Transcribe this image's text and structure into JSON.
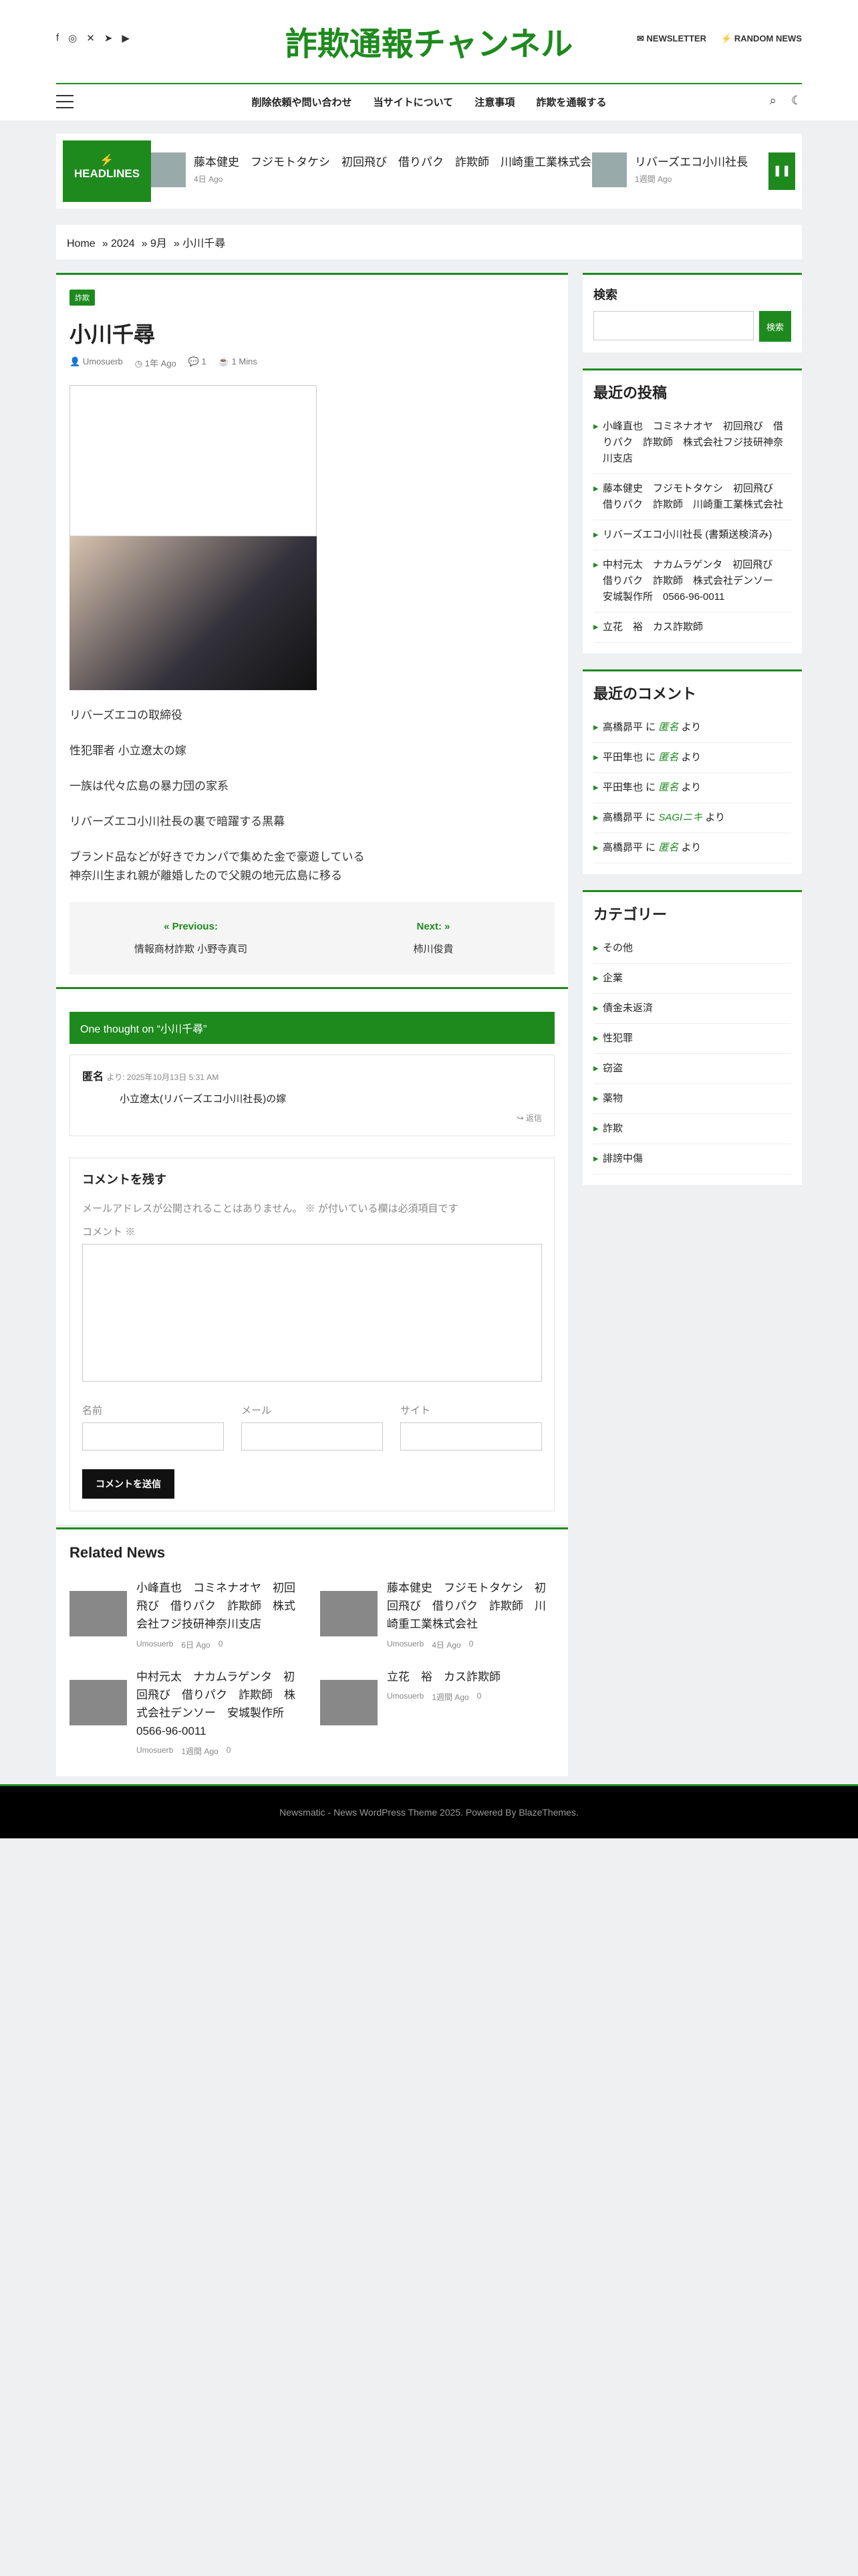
{
  "header": {
    "site_title": "詐欺通報チャンネル",
    "social_icons": [
      "facebook-icon",
      "instagram-icon",
      "x-icon",
      "telegram-icon",
      "youtube-icon"
    ],
    "newsletter": "NEWSLETTER",
    "random": "RANDOM NEWS"
  },
  "nav": {
    "items": [
      "削除依頼や問い合わせ",
      "当サイトについて",
      "注意事項",
      "詐欺を通報する"
    ]
  },
  "headlines": {
    "label": "HEADLINES",
    "items": [
      {
        "title": "藤本健史　フジモトタケシ　初回飛び　借りパク　詐欺師　川崎重工業株式会社",
        "time": "4日 Ago"
      },
      {
        "title": "リバーズエコ小川社長",
        "time": "1週間 Ago"
      }
    ]
  },
  "breadcrumb": [
    "Home",
    "2024",
    "9月",
    "小川千尋"
  ],
  "post": {
    "badge": "詐欺",
    "title": "小川千尋",
    "author": "Umosuerb",
    "time": "1年 Ago",
    "comments": "1",
    "read": "1 Mins",
    "paragraphs": [
      "リバーズエコの取締役",
      "性犯罪者 小立遼太の嫁",
      "一族は代々広島の暴力団の家系",
      "リバーズエコ小川社長の裏で暗躍する黒幕",
      "ブランド品などが好きでカンパで集めた金で豪遊している\n神奈川生まれ親が離婚したので父親の地元広島に移る"
    ],
    "prev_label": "Previous:",
    "prev_title": "情報商材詐欺 小野寺真司",
    "next_label": "Next:",
    "next_title": "柿川俊貴"
  },
  "comments": {
    "heading": "One thought on “小川千尋”",
    "author": "匿名",
    "date": "より: 2025年10月13日 5:31 AM",
    "text": "小立遼太(リバーズエコ小川社長)の嫁",
    "reply": "返信",
    "form_title": "コメントを残す",
    "notice": "メールアドレスが公開されることはありません。 ※ が付いている欄は必須項目です",
    "comment_label": "コメント ※",
    "name_label": "名前",
    "email_label": "メール",
    "site_label": "サイト",
    "submit": "コメントを送信"
  },
  "related": {
    "heading": "Related News",
    "items": [
      {
        "title": "小峰直也　コミネナオヤ　初回飛び　借りパク　詐欺師　株式会社フジ技研神奈川支店",
        "time": "6日 Ago",
        "comments": "0"
      },
      {
        "title": "藤本健史　フジモトタケシ　初回飛び　借りパク　詐欺師　川崎重工業株式会社",
        "time": "4日 Ago",
        "comments": "0"
      },
      {
        "title": "中村元太　ナカムラゲンタ　初回飛び　借りパク　詐欺師　株式会社デンソー　安城製作所　0566-96-0011",
        "time": "1週間 Ago",
        "comments": "0"
      },
      {
        "title": "立花　裕　カス詐欺師",
        "time": "1週間 Ago",
        "comments": "0"
      }
    ],
    "author": "Umosuerb"
  },
  "sidebar": {
    "search_title": "検索",
    "search_button": "検索",
    "recent_title": "最近の投稿",
    "recent": [
      "小峰直也　コミネナオヤ　初回飛び　借りパク　詐欺師　株式会社フジ技研神奈川支店",
      "藤本健史　フジモトタケシ　初回飛び　借りパク　詐欺師　川崎重工業株式会社",
      "リバーズエコ小川社長 (書類送検済み)",
      "中村元太　ナカムラゲンタ　初回飛び　借りパク　詐欺師　株式会社デンソー　安城製作所　0566-96-0011",
      "立花　裕　カス詐欺師"
    ],
    "comments_title": "最近のコメント",
    "comments": [
      {
        "who": "高橋昴平",
        "on": "匿名"
      },
      {
        "who": "平田隼也",
        "on": "匿名"
      },
      {
        "who": "平田隼也",
        "on": "匿名"
      },
      {
        "who": "高橋昴平",
        "on": "SAGIニキ"
      },
      {
        "who": "高橋昴平",
        "on": "匿名"
      }
    ],
    "categories_title": "カテゴリー",
    "categories": [
      "その他",
      "企業",
      "債金未返済",
      "性犯罪",
      "窃盗",
      "薬物",
      "詐欺",
      "誹謗中傷"
    ]
  },
  "footer": {
    "text": "Newsmatic - News WordPress Theme 2025. Powered By BlazeThemes."
  }
}
